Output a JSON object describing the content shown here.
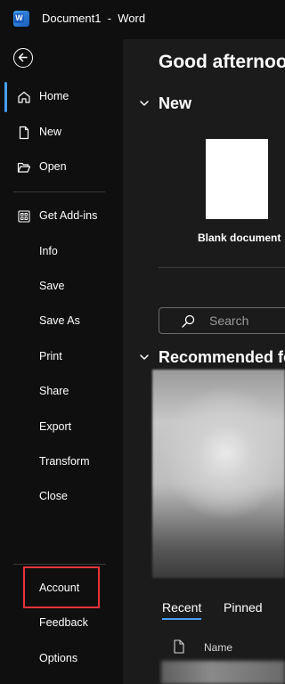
{
  "app": {
    "window_title": "Document1  -  Word",
    "logo_letter": "W"
  },
  "sidebar": {
    "items": [
      {
        "label": "Home",
        "icon": "home-icon",
        "active": true
      },
      {
        "label": "New",
        "icon": "new-document-icon"
      },
      {
        "label": "Open",
        "icon": "open-folder-icon"
      },
      {
        "label": "Get Add-ins",
        "icon": "add-ins-grid-icon"
      },
      {
        "label": "Info"
      },
      {
        "label": "Save"
      },
      {
        "label": "Save As"
      },
      {
        "label": "Print"
      },
      {
        "label": "Share"
      },
      {
        "label": "Export"
      },
      {
        "label": "Transform"
      },
      {
        "label": "Close"
      },
      {
        "label": "Account",
        "highlighted": true
      },
      {
        "label": "Feedback"
      },
      {
        "label": "Options"
      }
    ]
  },
  "main": {
    "greeting": "Good afternoo",
    "new_section": {
      "title": "New",
      "blank_label": "Blank document"
    },
    "search": {
      "placeholder": "Search"
    },
    "recommended": {
      "title": "Recommended fo"
    },
    "tabs": [
      {
        "label": "Recent",
        "active": true
      },
      {
        "label": "Pinned"
      }
    ],
    "file_list": {
      "name_column": "Name"
    }
  },
  "colors": {
    "accent": "#479ef5",
    "highlight_box": "#e8343a",
    "sidebar_bg": "#0f0f0f",
    "main_bg": "#1b1b1b"
  }
}
